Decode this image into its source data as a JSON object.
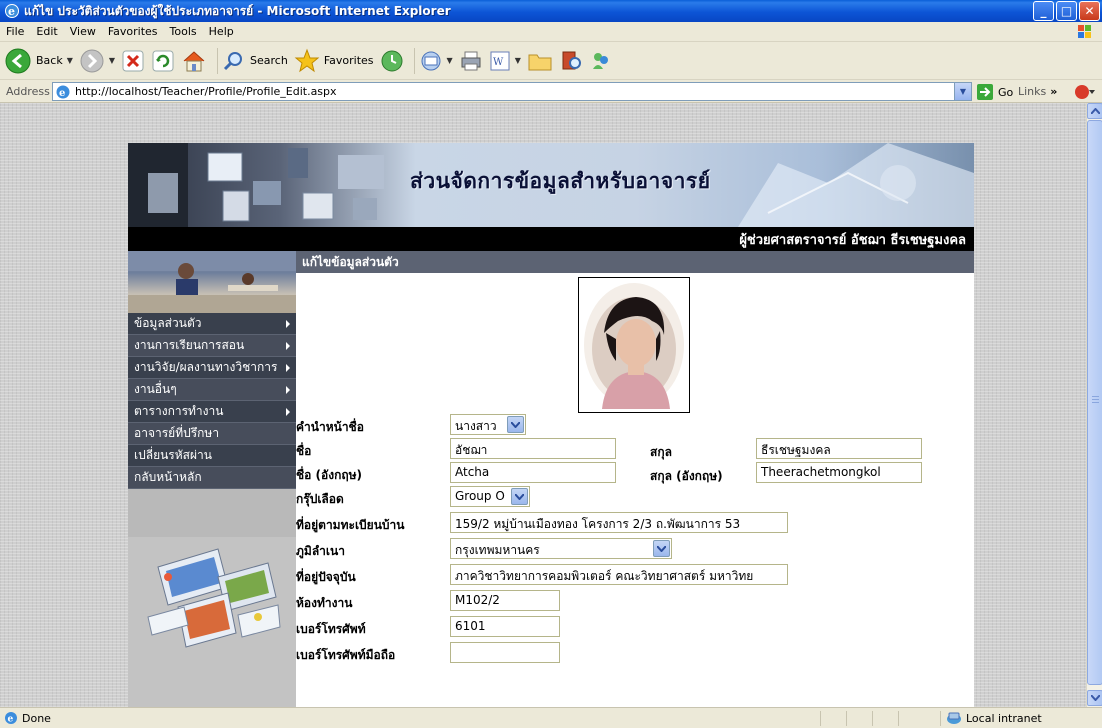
{
  "window": {
    "title": "แก้ไข ประวัติส่วนตัวของผู้ใช้ประเภทอาจารย์ - Microsoft Internet Explorer",
    "minimize": "_",
    "maximize": "□",
    "close": "✕"
  },
  "menu": [
    "File",
    "Edit",
    "View",
    "Favorites",
    "Tools",
    "Help"
  ],
  "toolbar": {
    "back_label": "Back",
    "search_label": "Search",
    "favorites_label": "Favorites"
  },
  "address": {
    "label": "Address",
    "url": "http://localhost/Teacher/Profile/Profile_Edit.aspx",
    "go_label": "Go",
    "links_label": "Links",
    "links_chevron": "»"
  },
  "page": {
    "banner_title": "ส่วนจัดการข้อมูลสำหรับอาจารย์",
    "user_name": "ผู้ช่วยศาสตราจารย์ อัชฌา ธีรเชษฐมงคล",
    "section_title": "แก้ไขข้อมูลส่วนตัว"
  },
  "sidebar": {
    "items": [
      {
        "label": "ข้อมูลส่วนตัว",
        "has_submenu": true
      },
      {
        "label": "งานการเรียนการสอน",
        "has_submenu": true
      },
      {
        "label": "งานวิจัย/ผลงานทางวิชาการ",
        "has_submenu": true
      },
      {
        "label": "งานอื่นๆ",
        "has_submenu": true
      },
      {
        "label": "ตารางการทำงาน",
        "has_submenu": true
      },
      {
        "label": "อาจารย์ที่ปรึกษา",
        "has_submenu": false
      },
      {
        "label": "เปลี่ยนรหัสผ่าน",
        "has_submenu": false
      },
      {
        "label": "กลับหน้าหลัก",
        "has_submenu": false
      }
    ]
  },
  "form": {
    "prefix": {
      "label": "คำนำหน้าชื่อ",
      "value": "นางสาว"
    },
    "first_name": {
      "label": "ชื่อ",
      "value": "อัชฌา"
    },
    "last_name": {
      "label": "สกุล",
      "value": "ธีรเชษฐมงคล"
    },
    "first_name_en": {
      "label": "ชื่อ (อังกฤษ)",
      "value": "Atcha"
    },
    "last_name_en": {
      "label": "สกุล (อังกฤษ)",
      "value": "Theerachetmongkol"
    },
    "blood_group": {
      "label": "กรุ๊ปเลือด",
      "value": "Group O"
    },
    "registered_address": {
      "label": "ที่อยู่ตามทะเบียนบ้าน",
      "value": "159/2 หมู่บ้านเมืองทอง โครงการ 2/3  ถ.พัฒนาการ 53"
    },
    "hometown": {
      "label": "ภูมิลำเนา",
      "value": "กรุงเทพมหานคร"
    },
    "current_address": {
      "label": "ที่อยู่ปัจจุบัน",
      "value": "ภาควิชาวิทยาการคอมพิวเตอร์ คณะวิทยาศาสตร์ มหาวิทย"
    },
    "office": {
      "label": "ห้องทำงาน",
      "value": "M102/2"
    },
    "phone": {
      "label": "เบอร์โทรศัพท์",
      "value": "6101"
    },
    "mobile": {
      "label": "เบอร์โทรศัพท์มือถือ",
      "value": ""
    }
  },
  "status": {
    "text": "Done",
    "zone": "Local intranet"
  },
  "colors": {
    "titlebar": "#0d55d6",
    "chrome": "#ece9d8",
    "sidebar_item": "#39404d",
    "section_header": "#5c6373"
  }
}
